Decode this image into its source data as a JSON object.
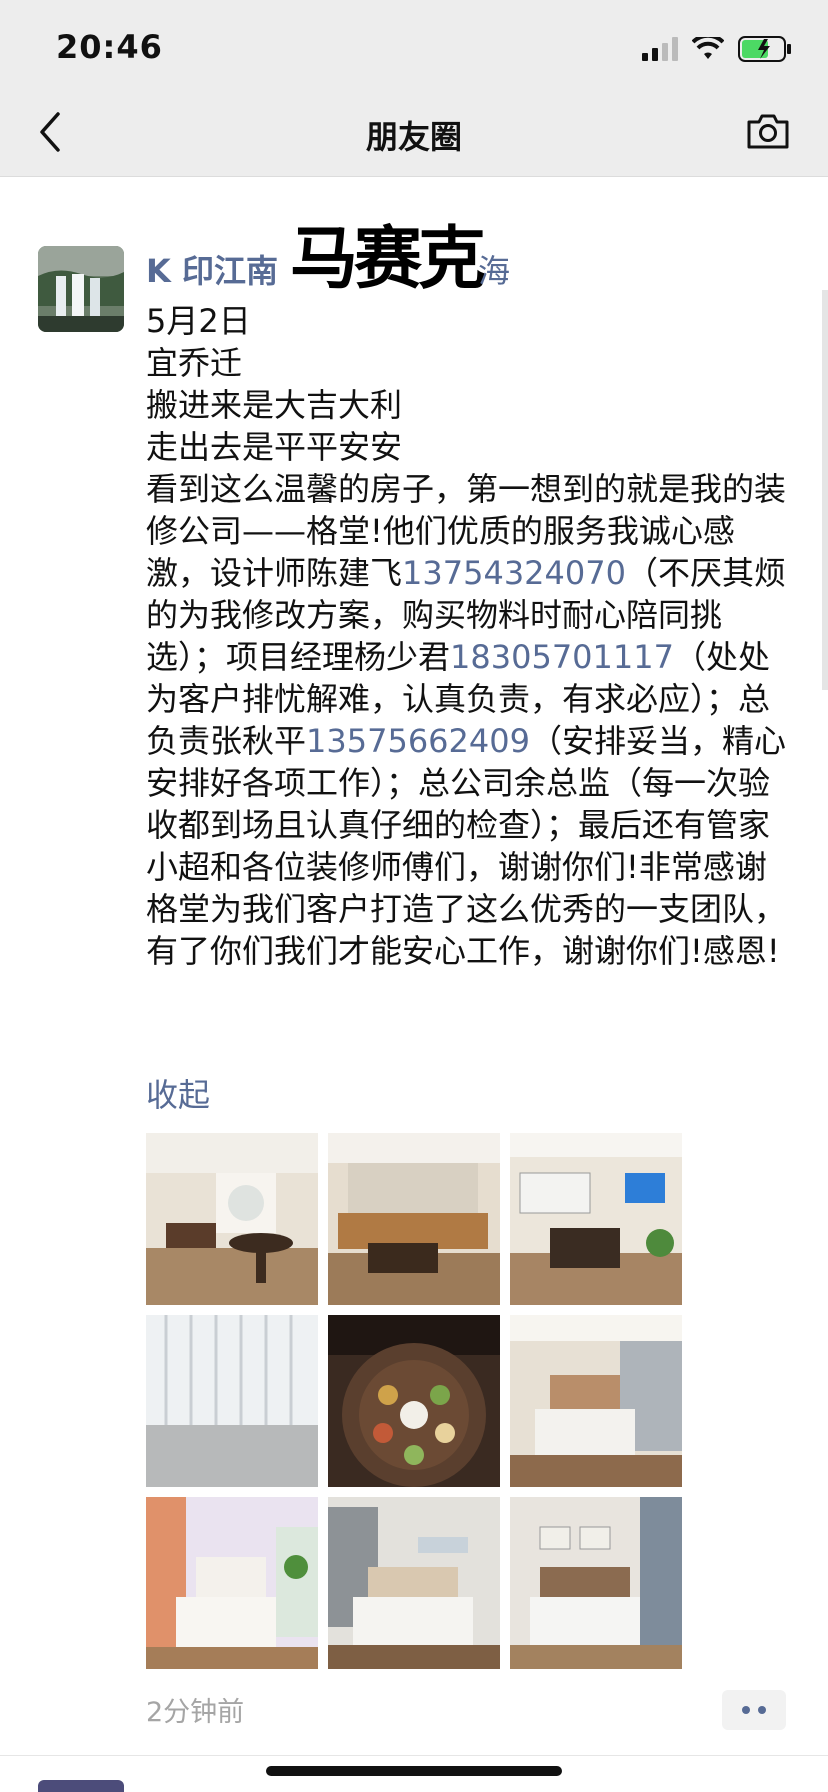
{
  "status_bar": {
    "time": "20:46"
  },
  "nav": {
    "title": "朋友圈"
  },
  "post": {
    "author": "K 印江南",
    "author_tail": "海",
    "name_stamp": "马赛克",
    "lines": [
      "5月2日",
      "宜乔迁",
      "搬进来是大吉大利",
      "走出去是平平安安"
    ],
    "body_part1": "看到这么温馨的房子，第一想到的就是我的装修公司——格堂!他们优质的服务我诚心感激，设计师陈建飞",
    "phone1": "13754324070",
    "body_part2": "（不厌其烦的为我修改方案，购买物料时耐心陪同挑选）；项目经理杨少君",
    "phone2": "18305701117",
    "body_part3": "（处处为客户排忧解难，认真负责，有求必应）；总负责张秋平",
    "phone3": "13575662409",
    "body_part4": "（安排妥当，精心安排好各项工作）；总公司余总监（每一次验收都到场且认真仔细的检查）；最后还有管家小超和各位装修师傅们，谢谢你们!非常感谢格堂为我们客户打造了这么优秀的一支团队，有了你们我们才能安心工作，谢谢你们!感恩!",
    "collapse_label": "收起",
    "time_ago": "2分钟前"
  }
}
